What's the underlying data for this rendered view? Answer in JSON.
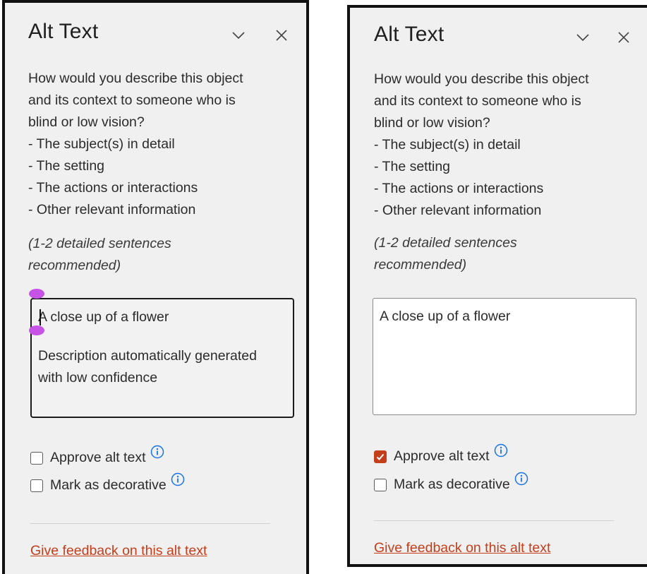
{
  "colors": {
    "accent": "#c43e1c",
    "info": "#1a73e8",
    "selection_handle": "#c752e6"
  },
  "icons": {
    "collapse": "chevron-down-icon",
    "close": "close-icon",
    "info": "info-icon",
    "check": "checkmark-icon"
  },
  "panes": [
    {
      "title": "Alt Text",
      "prompt_lines": [
        "How would you describe this object",
        "and its context to someone who is",
        "blind or low vision?",
        "- The subject(s) in detail",
        "- The setting",
        "- The actions or interactions",
        "- Other relevant information"
      ],
      "hint_lines": [
        "(1-2 detailed sentences",
        "recommended)"
      ],
      "alt_text_line1": "A close up of a flower",
      "alt_text_line2a": "Description automatically generated",
      "alt_text_line2b": "with low confidence",
      "approve_label": "Approve alt text",
      "approve_checked": false,
      "decorative_label": "Mark as decorative",
      "decorative_checked": false,
      "feedback_link": "Give feedback on this alt text"
    },
    {
      "title": "Alt Text",
      "prompt_lines": [
        "How would you describe this object",
        "and its context to someone who is",
        "blind or low vision?",
        "- The subject(s) in detail",
        "- The setting",
        "- The actions or interactions",
        "- Other relevant information"
      ],
      "hint_lines": [
        "(1-2 detailed sentences",
        "recommended)"
      ],
      "alt_text_line1": "A close up of a flower",
      "approve_label": "Approve alt text",
      "approve_checked": true,
      "decorative_label": "Mark as decorative",
      "decorative_checked": false,
      "feedback_link": "Give feedback on this alt text"
    }
  ]
}
